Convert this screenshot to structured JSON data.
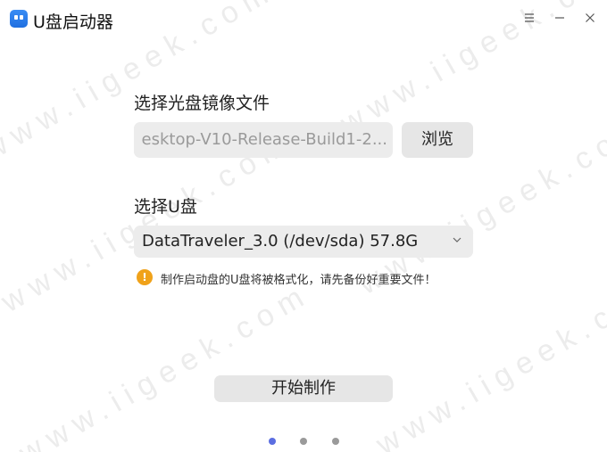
{
  "window": {
    "title": "U盘启动器",
    "menu_icon": "hamburger-menu-icon",
    "minimize_icon": "minimize-icon",
    "close_icon": "close-icon"
  },
  "iso": {
    "label": "选择光盘镜像文件",
    "value": "esktop-V10-Release-Build1-2...",
    "browse_label": "浏览"
  },
  "drive": {
    "label": "选择U盘",
    "selected": "DataTraveler_3.0 (/dev/sda) 57.8G",
    "dropdown_icon": "chevron-down-icon"
  },
  "warning": {
    "icon": "warning-icon",
    "text": "制作启动盘的U盘将被格式化，请先备份好重要文件！"
  },
  "actions": {
    "start_label": "开始制作"
  },
  "pagination": {
    "total": 3,
    "active": 1,
    "active_color": "#5b6ee1",
    "inactive_color": "#9a9a9a"
  },
  "watermark": "www.iigeek.com"
}
